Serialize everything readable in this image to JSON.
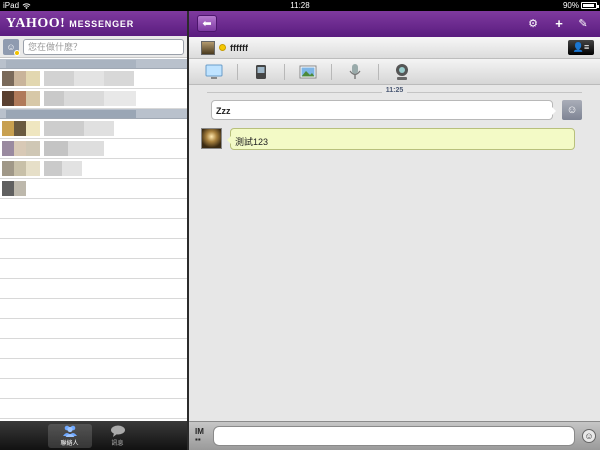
{
  "status_bar": {
    "device": "iPad",
    "time": "11:28",
    "battery": "90%"
  },
  "app": {
    "logo": "YAHOO!",
    "logo_sub": "MESSENGER"
  },
  "status_input": {
    "placeholder": "您在做什麼？"
  },
  "contacts_pixelated": true,
  "tabs": [
    {
      "label": "聯絡人",
      "icon": "contacts-icon",
      "active": true
    },
    {
      "label": "訊息",
      "icon": "chat-bubble-icon",
      "active": false
    }
  ],
  "conversation": {
    "contact_name": "ffffff",
    "timestamp": "11:25",
    "messages": [
      {
        "direction": "outgoing",
        "text": "Zzz"
      },
      {
        "direction": "incoming",
        "text": "測試123"
      }
    ]
  },
  "actions": [
    "display-icon",
    "phone-icon",
    "photo-icon",
    "microphone-icon",
    "webcam-icon"
  ],
  "header_icons": [
    "gear-icon",
    "plus-icon",
    "compose-icon"
  ],
  "input": {
    "im_label": "IM",
    "value": ""
  },
  "colors": {
    "header_purple": "#6a2a8f",
    "incoming_bubble": "#f3fac6",
    "status_yellow": "#f5c800"
  }
}
